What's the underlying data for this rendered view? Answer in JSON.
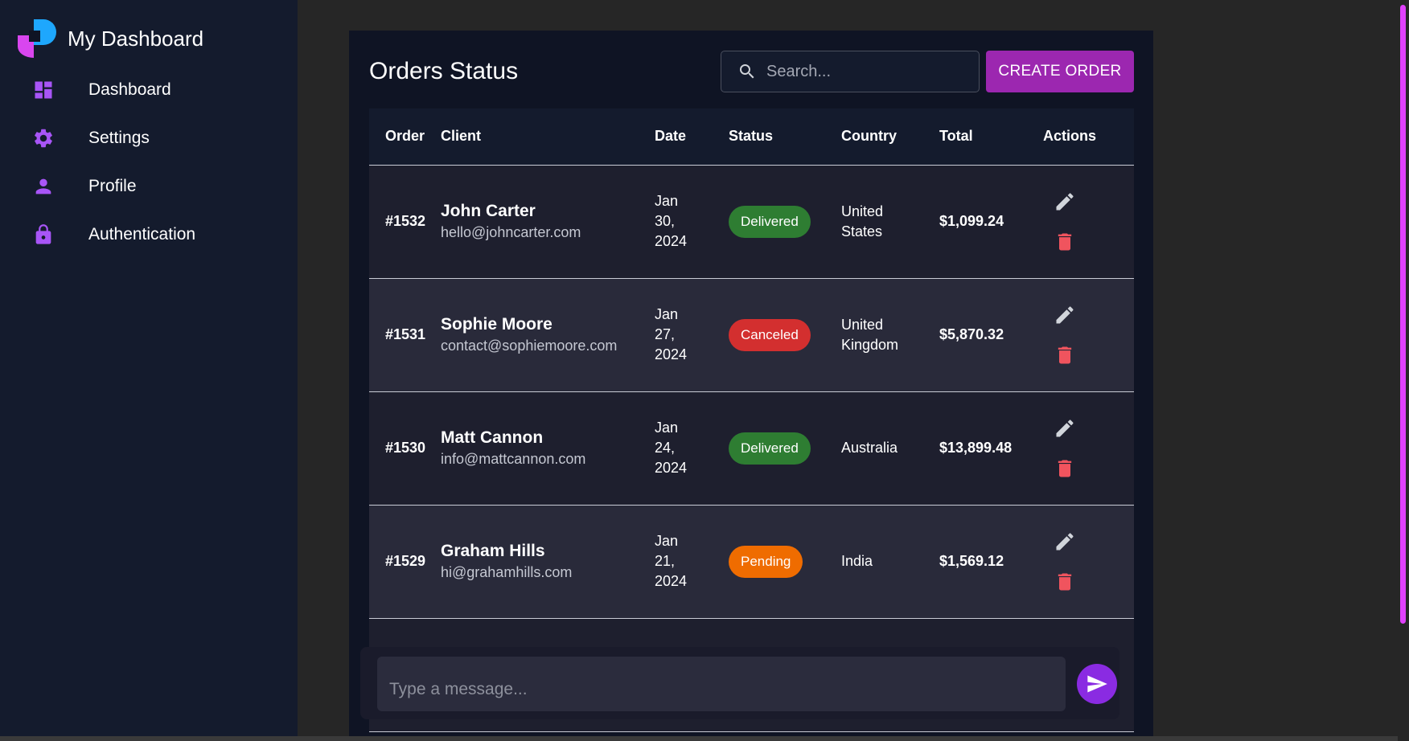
{
  "app": {
    "title": "My Dashboard"
  },
  "sidebar": {
    "items": [
      {
        "label": "Dashboard",
        "icon": "dashboard-icon"
      },
      {
        "label": "Settings",
        "icon": "gear-icon"
      },
      {
        "label": "Profile",
        "icon": "person-icon"
      },
      {
        "label": "Authentication",
        "icon": "lock-icon"
      }
    ]
  },
  "header": {
    "title": "Orders Status",
    "search_placeholder": "Search...",
    "create_label": "CREATE ORDER"
  },
  "table": {
    "columns": [
      "Order",
      "Client",
      "Date",
      "Status",
      "Country",
      "Total",
      "Actions"
    ],
    "rows": [
      {
        "order": "#1532",
        "client_name": "John Carter",
        "client_email": "hello@johncarter.com",
        "date_month": "Jan",
        "date_day": "30,",
        "date_year": "2024",
        "status": "Delivered",
        "country_line1": "United",
        "country_line2": "States",
        "total": "$1,099.24"
      },
      {
        "order": "#1531",
        "client_name": "Sophie Moore",
        "client_email": "contact@sophiemoore.com",
        "date_month": "Jan",
        "date_day": "27,",
        "date_year": "2024",
        "status": "Canceled",
        "country_line1": "United",
        "country_line2": "Kingdom",
        "total": "$5,870.32"
      },
      {
        "order": "#1530",
        "client_name": "Matt Cannon",
        "client_email": "info@mattcannon.com",
        "date_month": "Jan",
        "date_day": "24,",
        "date_year": "2024",
        "status": "Delivered",
        "country_line1": "Australia",
        "country_line2": "",
        "total": "$13,899.48"
      },
      {
        "order": "#1529",
        "client_name": "Graham Hills",
        "client_email": "hi@grahamhills.com",
        "date_month": "Jan",
        "date_day": "21,",
        "date_year": "2024",
        "status": "Pending",
        "country_line1": "India",
        "country_line2": "",
        "total": "$1,569.12"
      }
    ]
  },
  "status_colors": {
    "Delivered": "#2e7d32",
    "Canceled": "#d32f2f",
    "Pending": "#ef6c00"
  },
  "message": {
    "placeholder": "Type a message..."
  },
  "colors": {
    "accent": "#9c27b0",
    "sidebar_bg": "#141b2d",
    "send_button": "#8a2be2"
  }
}
